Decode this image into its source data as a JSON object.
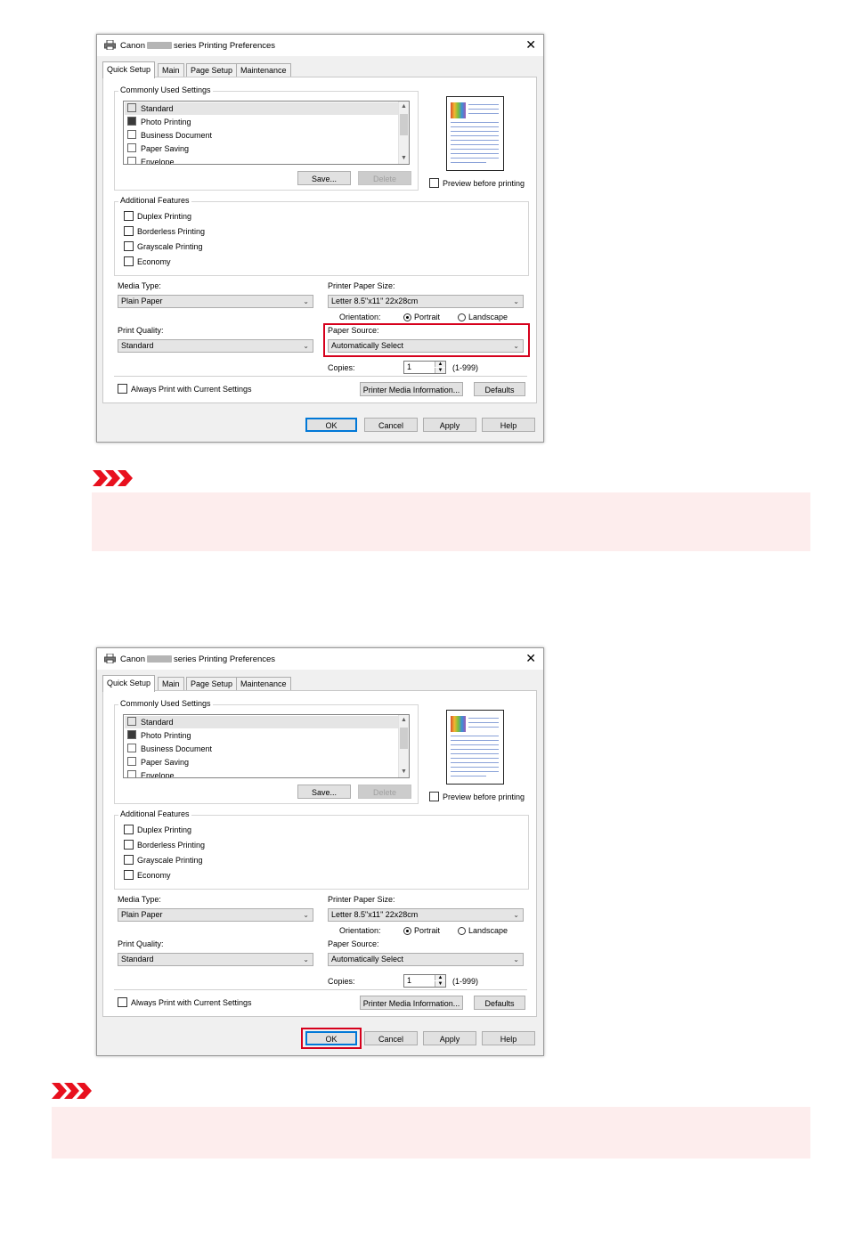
{
  "dialog": {
    "title_prefix": "Canon",
    "title_suffix": "series Printing Preferences",
    "close_glyph": "✕",
    "tabs": [
      "Quick Setup",
      "Main",
      "Page Setup",
      "Maintenance"
    ],
    "commonly_used_settings": {
      "legend": "Commonly Used Settings",
      "items": [
        "Standard",
        "Photo Printing",
        "Business Document",
        "Paper Saving",
        "Envelope"
      ],
      "selected": "Standard",
      "save_label": "Save...",
      "delete_label": "Delete"
    },
    "preview_before_printing": "Preview before printing",
    "additional_features": {
      "legend": "Additional Features",
      "items": [
        "Duplex Printing",
        "Borderless Printing",
        "Grayscale Printing",
        "Economy"
      ]
    },
    "media_type": {
      "label": "Media Type:",
      "value": "Plain Paper"
    },
    "printer_paper_size": {
      "label": "Printer Paper Size:",
      "value": "Letter 8.5\"x11\" 22x28cm"
    },
    "orientation": {
      "label": "Orientation:",
      "portrait": "Portrait",
      "landscape": "Landscape",
      "selected": "Portrait"
    },
    "print_quality": {
      "label": "Print Quality:",
      "value": "Standard"
    },
    "paper_source": {
      "label": "Paper Source:",
      "value": "Automatically Select"
    },
    "copies": {
      "label": "Copies:",
      "value": "1",
      "range": "(1-999)"
    },
    "always_print": "Always Print with Current Settings",
    "printer_media_info": "Printer Media Information...",
    "defaults": "Defaults",
    "ok": "OK",
    "cancel": "Cancel",
    "apply": "Apply",
    "help": "Help"
  },
  "colors": {
    "highlight": "#d6001c",
    "note_background": "#fdeded",
    "note_icon": "#e8101e"
  },
  "icons": {
    "note": "triple-chevron-icon",
    "printer": "printer-icon"
  }
}
